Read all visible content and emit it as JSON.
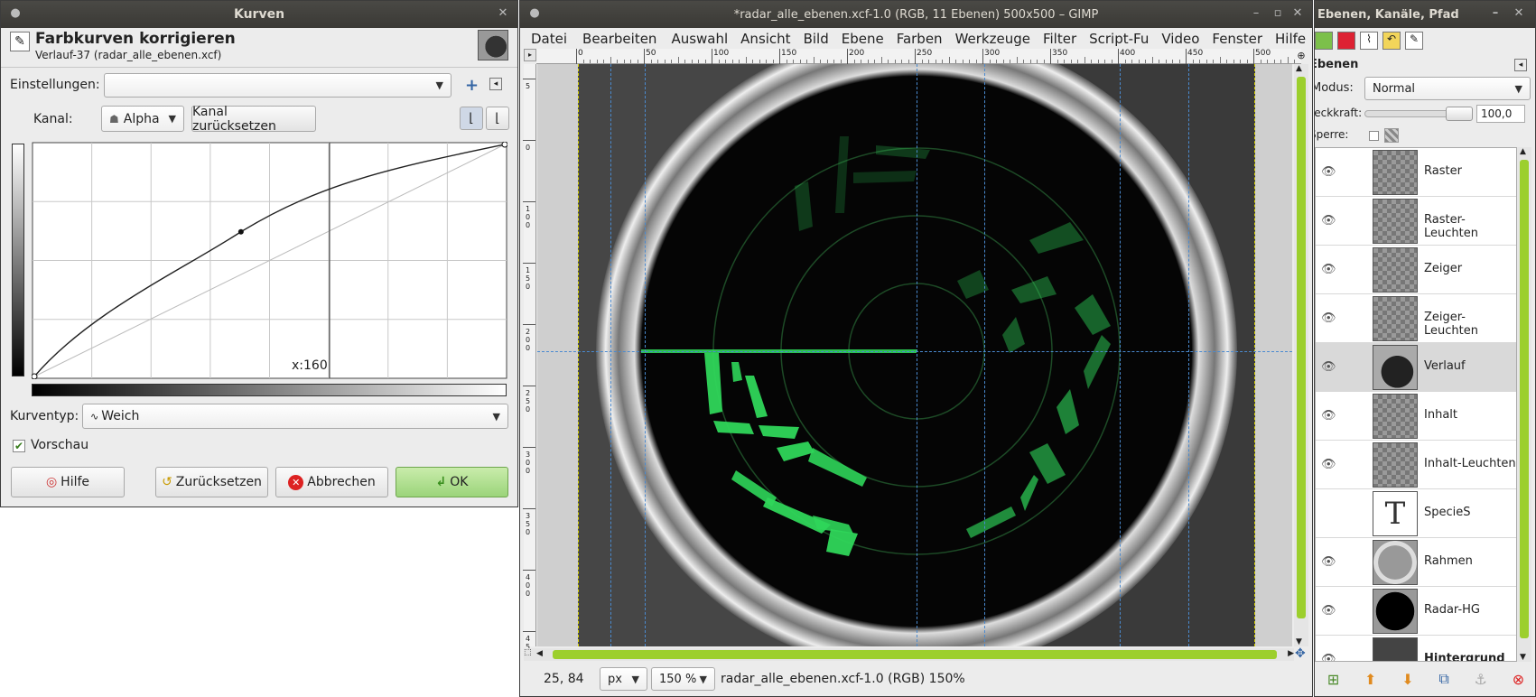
{
  "curves_dialog": {
    "window_title": "Kurven",
    "heading": "Farbkurven korrigieren",
    "subheading": "Verlauf-37 (radar_alle_ebenen.xcf)",
    "settings_label": "Einstellungen:",
    "settings_value": "",
    "channel_label": "Kanal:",
    "channel_value": "Alpha",
    "reset_channel_label": "Kanal zurücksetzen",
    "curve_readout": "x:160",
    "curve_type_label": "Kurventyp:",
    "curve_type_value": "Weich",
    "preview_label": "Vorschau",
    "preview_checked": true,
    "buttons": {
      "help": "Hilfe",
      "reset": "Zurücksetzen",
      "cancel": "Abbrechen",
      "ok": "OK"
    },
    "curve_points": [
      [
        0,
        0
      ],
      [
        112,
        159
      ],
      [
        255,
        255
      ]
    ]
  },
  "image_window": {
    "title": "*radar_alle_ebenen.xcf-1.0 (RGB, 11 Ebenen) 500x500 – GIMP",
    "menu": [
      "Datei",
      "Bearbeiten",
      "Auswahl",
      "Ansicht",
      "Bild",
      "Ebene",
      "Farben",
      "Werkzeuge",
      "Filter",
      "Script-Fu",
      "Video",
      "Fenster",
      "Hilfe"
    ],
    "ruler_marks": [
      "0",
      "50",
      "100",
      "150",
      "200",
      "250",
      "300",
      "350",
      "400",
      "450",
      "500"
    ],
    "vruler_marks": [
      "5",
      "0",
      "1 0 0",
      "1 5 0",
      "2 0 0",
      "2 5 0",
      "3 0 0",
      "3 5 0",
      "4 0 0",
      "4 5 0"
    ],
    "status": {
      "coords": "25, 84",
      "unit": "px",
      "zoom": "150 %",
      "info": "radar_alle_ebenen.xcf-1.0 (RGB) 150%"
    }
  },
  "layers_panel": {
    "title": "Ebenen, Kanäle, Pfad",
    "section_title": "Ebenen",
    "mode_label": "Modus:",
    "mode_value": "Normal",
    "opacity_label": "Deckkraft:",
    "opacity_value": "100,0",
    "lock_label": "Sperre:",
    "layers": [
      {
        "name": "Raster",
        "visible": true
      },
      {
        "name": "Raster-Leuchten",
        "visible": true
      },
      {
        "name": "Zeiger",
        "visible": true
      },
      {
        "name": "Zeiger-Leuchten",
        "visible": true
      },
      {
        "name": "Verlauf",
        "visible": true,
        "selected": true
      },
      {
        "name": "Inhalt",
        "visible": true
      },
      {
        "name": "Inhalt-Leuchten",
        "visible": true
      },
      {
        "name": "SpecieS",
        "visible": false
      },
      {
        "name": "Rahmen",
        "visible": true
      },
      {
        "name": "Radar-HG",
        "visible": true
      },
      {
        "name": "Hintergrund",
        "visible": true
      }
    ]
  },
  "colors": {
    "radar_green": "#2fd65a",
    "scrollbar_green": "#9ccf2d",
    "title_bar": "#3c3b37"
  }
}
